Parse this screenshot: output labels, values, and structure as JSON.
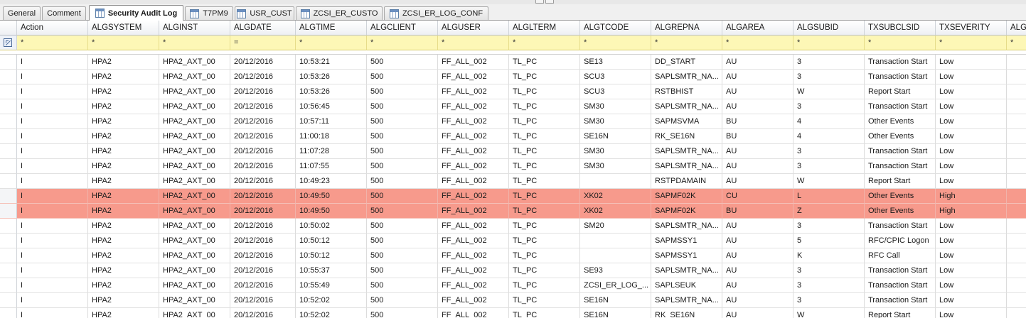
{
  "tabs": [
    {
      "label": "General",
      "icon": "none",
      "active": false
    },
    {
      "label": "Comment",
      "icon": "none",
      "active": false
    },
    {
      "label": "Security Audit Log",
      "icon": "table-icon",
      "active": true
    },
    {
      "label": "T7PM9",
      "icon": "table-icon",
      "active": false
    },
    {
      "label": "USR_CUST",
      "icon": "table-icon",
      "active": false
    },
    {
      "label": "ZCSI_ER_CUSTO",
      "icon": "table-icon",
      "active": false
    },
    {
      "label": "ZCSI_ER_LOG_CONF",
      "icon": "table-icon",
      "active": false
    }
  ],
  "columns": [
    "Action",
    "ALGSYSTEM",
    "ALGINST",
    "ALGDATE",
    "ALGTIME",
    "ALGCLIENT",
    "ALGUSER",
    "ALGLTERM",
    "ALGTCODE",
    "ALGREPNA",
    "ALGAREA",
    "ALGSUBID",
    "TXSUBCLSID",
    "TXSEVERITY",
    "ALG"
  ],
  "filters": [
    "*",
    "*",
    "*",
    "=",
    "*",
    "*",
    "*",
    "*",
    "*",
    "*",
    "*",
    "*",
    "*",
    "*",
    "*"
  ],
  "colors": {
    "highlight_row": "#f79a8c",
    "filter_row": "#fdf7b6"
  },
  "rows": [
    {
      "cells": [
        "I",
        "HPA2",
        "HPA2_AXT_00",
        "20/12/2016",
        "10:53:21",
        "500",
        "FF_ALL_002",
        "TL_PC",
        "SE13",
        "DD_START",
        "AU",
        "3",
        "Transaction Start",
        "Low",
        ""
      ],
      "highlight": false
    },
    {
      "cells": [
        "I",
        "HPA2",
        "HPA2_AXT_00",
        "20/12/2016",
        "10:53:26",
        "500",
        "FF_ALL_002",
        "TL_PC",
        "SCU3",
        "SAPLSMTR_NA...",
        "AU",
        "3",
        "Transaction Start",
        "Low",
        ""
      ],
      "highlight": false
    },
    {
      "cells": [
        "I",
        "HPA2",
        "HPA2_AXT_00",
        "20/12/2016",
        "10:53:26",
        "500",
        "FF_ALL_002",
        "TL_PC",
        "SCU3",
        "RSTBHIST",
        "AU",
        "W",
        "Report Start",
        "Low",
        ""
      ],
      "highlight": false
    },
    {
      "cells": [
        "I",
        "HPA2",
        "HPA2_AXT_00",
        "20/12/2016",
        "10:56:45",
        "500",
        "FF_ALL_002",
        "TL_PC",
        "SM30",
        "SAPLSMTR_NA...",
        "AU",
        "3",
        "Transaction Start",
        "Low",
        ""
      ],
      "highlight": false
    },
    {
      "cells": [
        "I",
        "HPA2",
        "HPA2_AXT_00",
        "20/12/2016",
        "10:57:11",
        "500",
        "FF_ALL_002",
        "TL_PC",
        "SM30",
        "SAPMSVMA",
        "BU",
        "4",
        "Other Events",
        "Low",
        ""
      ],
      "highlight": false
    },
    {
      "cells": [
        "I",
        "HPA2",
        "HPA2_AXT_00",
        "20/12/2016",
        "11:00:18",
        "500",
        "FF_ALL_002",
        "TL_PC",
        "SE16N",
        "RK_SE16N",
        "BU",
        "4",
        "Other Events",
        "Low",
        ""
      ],
      "highlight": false
    },
    {
      "cells": [
        "I",
        "HPA2",
        "HPA2_AXT_00",
        "20/12/2016",
        "11:07:28",
        "500",
        "FF_ALL_002",
        "TL_PC",
        "SM30",
        "SAPLSMTR_NA...",
        "AU",
        "3",
        "Transaction Start",
        "Low",
        ""
      ],
      "highlight": false
    },
    {
      "cells": [
        "I",
        "HPA2",
        "HPA2_AXT_00",
        "20/12/2016",
        "11:07:55",
        "500",
        "FF_ALL_002",
        "TL_PC",
        "SM30",
        "SAPLSMTR_NA...",
        "AU",
        "3",
        "Transaction Start",
        "Low",
        ""
      ],
      "highlight": false
    },
    {
      "cells": [
        "I",
        "HPA2",
        "HPA2_AXT_00",
        "20/12/2016",
        "10:49:23",
        "500",
        "FF_ALL_002",
        "TL_PC",
        "",
        "RSTPDAMAIN",
        "AU",
        "W",
        "Report Start",
        "Low",
        ""
      ],
      "highlight": false
    },
    {
      "cells": [
        "I",
        "HPA2",
        "HPA2_AXT_00",
        "20/12/2016",
        "10:49:50",
        "500",
        "FF_ALL_002",
        "TL_PC",
        "XK02",
        "SAPMF02K",
        "CU",
        "L",
        "Other Events",
        "High",
        ""
      ],
      "highlight": true
    },
    {
      "cells": [
        "I",
        "HPA2",
        "HPA2_AXT_00",
        "20/12/2016",
        "10:49:50",
        "500",
        "FF_ALL_002",
        "TL_PC",
        "XK02",
        "SAPMF02K",
        "BU",
        "Z",
        "Other Events",
        "High",
        ""
      ],
      "highlight": true
    },
    {
      "cells": [
        "I",
        "HPA2",
        "HPA2_AXT_00",
        "20/12/2016",
        "10:50:02",
        "500",
        "FF_ALL_002",
        "TL_PC",
        "SM20",
        "SAPLSMTR_NA...",
        "AU",
        "3",
        "Transaction Start",
        "Low",
        ""
      ],
      "highlight": false
    },
    {
      "cells": [
        "I",
        "HPA2",
        "HPA2_AXT_00",
        "20/12/2016",
        "10:50:12",
        "500",
        "FF_ALL_002",
        "TL_PC",
        "",
        "SAPMSSY1",
        "AU",
        "5",
        "RFC/CPIC Logon",
        "Low",
        ""
      ],
      "highlight": false
    },
    {
      "cells": [
        "I",
        "HPA2",
        "HPA2_AXT_00",
        "20/12/2016",
        "10:50:12",
        "500",
        "FF_ALL_002",
        "TL_PC",
        "",
        "SAPMSSY1",
        "AU",
        "K",
        "RFC Call",
        "Low",
        ""
      ],
      "highlight": false
    },
    {
      "cells": [
        "I",
        "HPA2",
        "HPA2_AXT_00",
        "20/12/2016",
        "10:55:37",
        "500",
        "FF_ALL_002",
        "TL_PC",
        "SE93",
        "SAPLSMTR_NA...",
        "AU",
        "3",
        "Transaction Start",
        "Low",
        ""
      ],
      "highlight": false
    },
    {
      "cells": [
        "I",
        "HPA2",
        "HPA2_AXT_00",
        "20/12/2016",
        "10:55:49",
        "500",
        "FF_ALL_002",
        "TL_PC",
        "ZCSI_ER_LOG_...",
        "SAPLSEUK",
        "AU",
        "3",
        "Transaction Start",
        "Low",
        ""
      ],
      "highlight": false
    },
    {
      "cells": [
        "I",
        "HPA2",
        "HPA2_AXT_00",
        "20/12/2016",
        "10:52:02",
        "500",
        "FF_ALL_002",
        "TL_PC",
        "SE16N",
        "SAPLSMTR_NA...",
        "AU",
        "3",
        "Transaction Start",
        "Low",
        ""
      ],
      "highlight": false
    },
    {
      "cells": [
        "I",
        "HPA2",
        "HPA2_AXT_00",
        "20/12/2016",
        "10:52:02",
        "500",
        "FF_ALL_002",
        "TL_PC",
        "SE16N",
        "RK_SE16N",
        "AU",
        "W",
        "Report Start",
        "Low",
        ""
      ],
      "highlight": false
    }
  ]
}
